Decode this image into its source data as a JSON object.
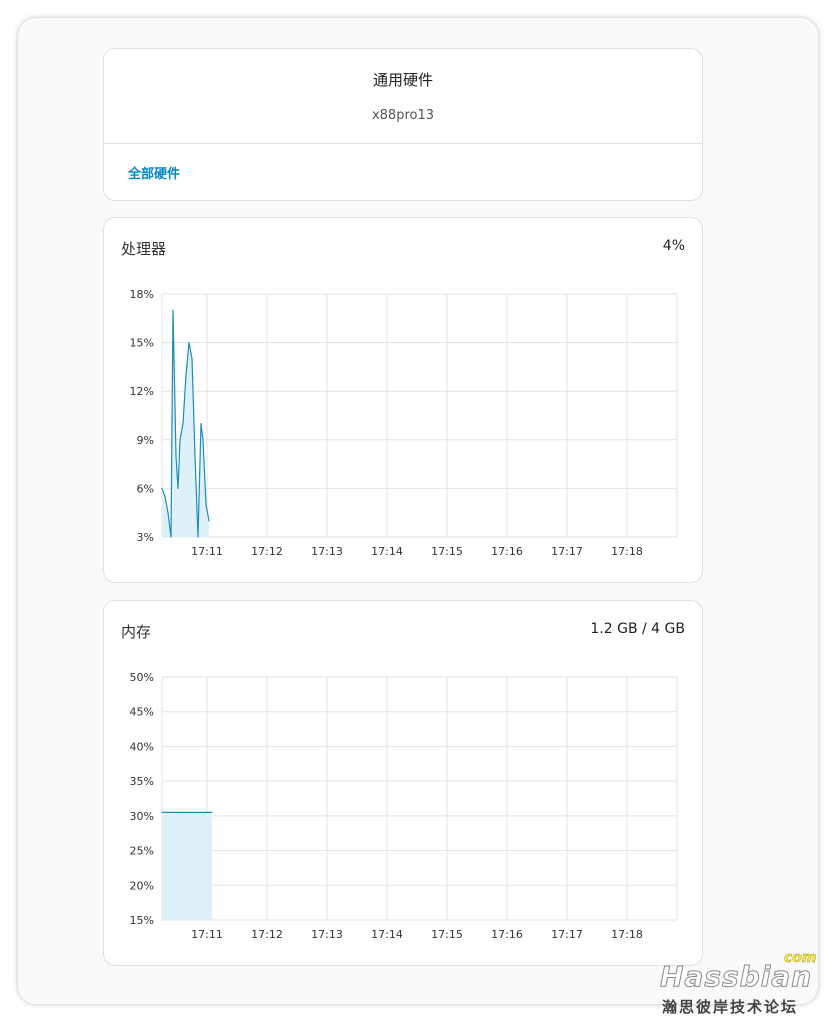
{
  "info": {
    "title": "通用硬件",
    "subtitle": "x88pro13",
    "link": "全部硬件"
  },
  "cpu": {
    "title": "处理器",
    "value": "4%"
  },
  "memory": {
    "title": "内存",
    "value": "1.2 GB / 4 GB"
  },
  "watermark": {
    "logo": "Hassbian",
    "logo_suffix": "com",
    "caption": "瀚思彼岸技术论坛"
  },
  "colors": {
    "line": "#1b8db8",
    "fill": "#dff1f8",
    "link": "#0288c7"
  },
  "chart_data": [
    {
      "type": "area",
      "title": "",
      "ylim": [
        3,
        18
      ],
      "yticks": [
        "3%",
        "6%",
        "9%",
        "12%",
        "15%",
        "18%"
      ],
      "xlim": [
        "17:10:15",
        "17:18:50"
      ],
      "xticks": [
        "17:11",
        "17:12",
        "17:13",
        "17:14",
        "17:15",
        "17:16",
        "17:17",
        "17:18"
      ],
      "grid": true,
      "series": [
        {
          "x": [
            "17:10:15",
            "17:10:18",
            "17:10:21",
            "17:10:24",
            "17:10:26",
            "17:10:29",
            "17:10:31",
            "17:10:33",
            "17:10:36",
            "17:10:39",
            "17:10:42",
            "17:10:45",
            "17:10:48",
            "17:10:51",
            "17:10:54",
            "17:10:56",
            "17:10:59",
            "17:11:02"
          ],
          "y": [
            6,
            5.5,
            4.5,
            3,
            17,
            8,
            6,
            9,
            10,
            13,
            15,
            14,
            8,
            3,
            10,
            9,
            5,
            4
          ]
        }
      ]
    },
    {
      "type": "area",
      "title": "",
      "ylim": [
        15,
        50
      ],
      "yticks": [
        "15%",
        "20%",
        "25%",
        "30%",
        "35%",
        "40%",
        "45%",
        "50%"
      ],
      "xlim": [
        "17:10:15",
        "17:18:50"
      ],
      "xticks": [
        "17:11",
        "17:12",
        "17:13",
        "17:14",
        "17:15",
        "17:16",
        "17:17",
        "17:18"
      ],
      "grid": true,
      "series": [
        {
          "x": [
            "17:10:15",
            "17:11:05"
          ],
          "y": [
            30.5,
            30.5
          ]
        }
      ]
    }
  ]
}
